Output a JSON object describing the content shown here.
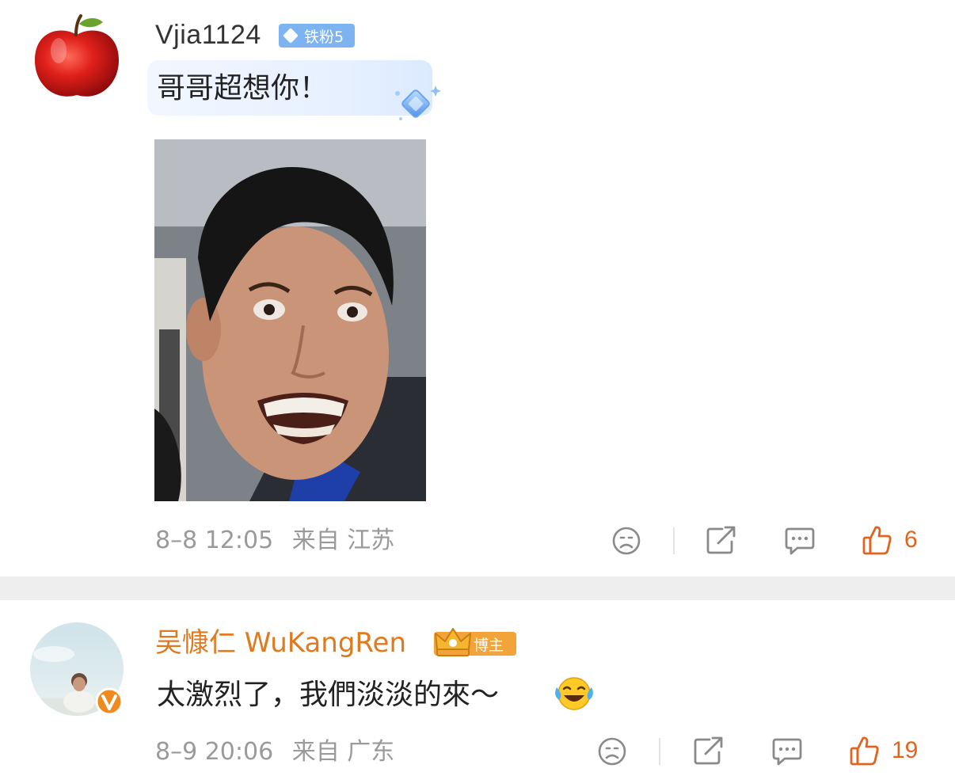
{
  "comments": [
    {
      "username": "Vjia1124",
      "badge": "铁粉5",
      "text": "哥哥超想你！",
      "date": "8–8 12:05",
      "source": "来自 江苏",
      "likes": "6"
    },
    {
      "username": "吴慷仁 WuKangRen",
      "badge": "博主",
      "text": "太激烈了，我們淡淡的來～",
      "date": "8–9 20:06",
      "source": "来自 广东",
      "likes": "19"
    }
  ],
  "icons": {
    "dislike": "sad-face-icon",
    "share": "share-icon",
    "comment": "comment-bubble-icon",
    "like": "thumbs-up-icon",
    "emoji": "laughing-tears-emoji"
  },
  "colors": {
    "accent": "#e0641e",
    "fan_badge": "#7eb3f2",
    "blogger_badge": "#f2a33a",
    "username_highlight": "#e07a1f",
    "meta_gray": "#9a9a9a",
    "divider": "#eeeeef"
  }
}
